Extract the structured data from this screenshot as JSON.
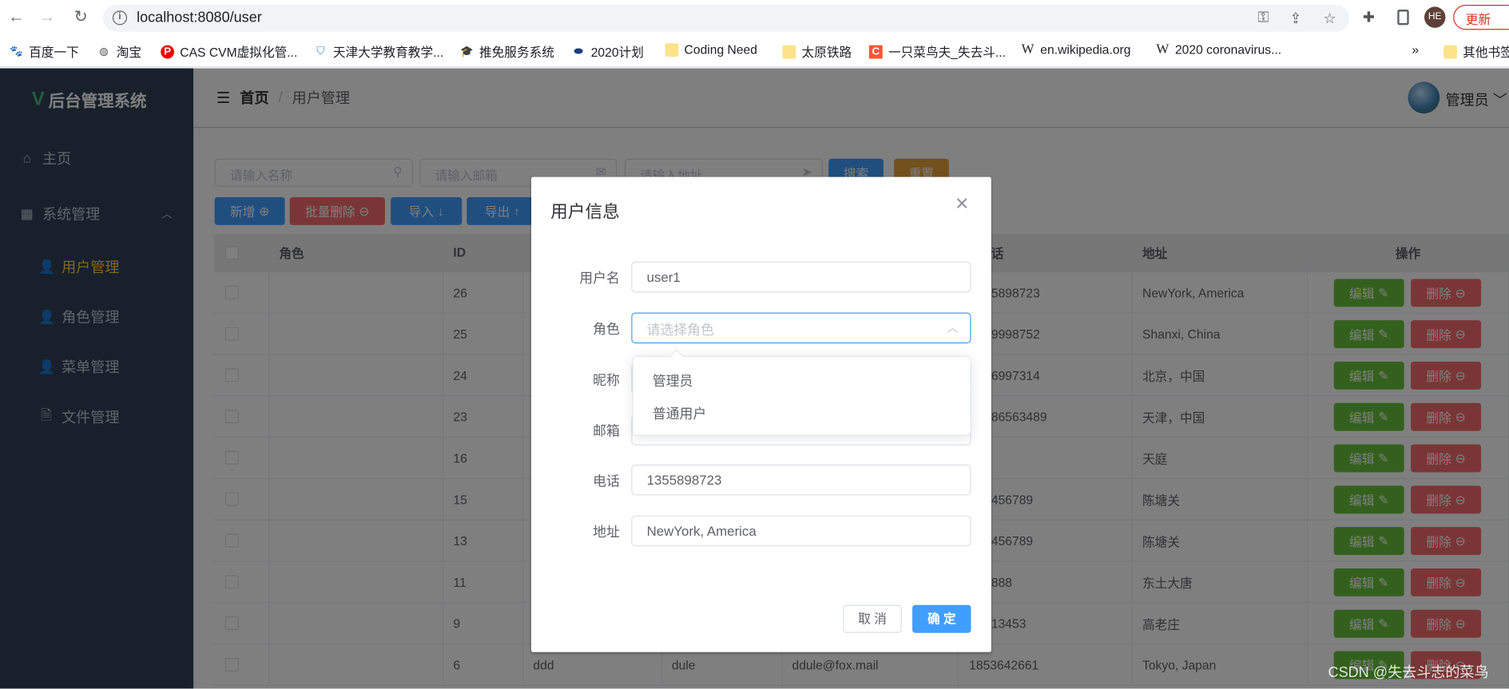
{
  "browser": {
    "url": "localhost:8080/user",
    "profile_initials": "HE",
    "update_label": "更新",
    "bookmarks": [
      "百度一下",
      "淘宝",
      "CAS CVM虚拟化管...",
      "天津大学教育教学...",
      "推免服务系统",
      "2020计划",
      "Coding Need",
      "太原铁路",
      "一只菜鸟夫_失去斗...",
      "en.wikipedia.org",
      "2020 coronavirus..."
    ],
    "more_bookmarks": "»",
    "other_bookmarks": "其他书签"
  },
  "sidebar": {
    "title": "后台管理系统",
    "logo_letter": "V",
    "items": [
      {
        "label": "主页",
        "icon": "home-icon"
      },
      {
        "label": "系统管理",
        "icon": "grid-icon"
      },
      {
        "label": "用户管理",
        "icon": "user-icon",
        "active": true
      },
      {
        "label": "角色管理",
        "icon": "user-icon"
      },
      {
        "label": "菜单管理",
        "icon": "user-icon"
      },
      {
        "label": "文件管理",
        "icon": "document-icon"
      }
    ]
  },
  "header": {
    "breadcrumb": [
      "首页",
      "用户管理"
    ],
    "separator": "/",
    "user": "管理员"
  },
  "search": {
    "name_placeholder": "请输入名称",
    "email_placeholder": "请输入邮箱",
    "address_placeholder": "请输入地址",
    "search_label": "搜索",
    "reset_label": "重置"
  },
  "toolbar": {
    "add": "新增",
    "batch_delete": "批量删除",
    "import": "导入",
    "export": "导出"
  },
  "table": {
    "columns": [
      "角色",
      "ID",
      "地址",
      "操作"
    ],
    "phone_header_fragment": "话",
    "edit_label": "编辑",
    "delete_label": "删除",
    "rows": [
      {
        "id": "26",
        "phone": "5898723",
        "address": "NewYork, America"
      },
      {
        "id": "25",
        "phone": "9998752",
        "address": "Shanxi, China"
      },
      {
        "id": "24",
        "phone": "6997314",
        "address": "北京，中国"
      },
      {
        "id": "23",
        "phone": "86563489",
        "address": "天津，中国"
      },
      {
        "id": "16",
        "phone": "",
        "address": "天庭"
      },
      {
        "id": "15",
        "phone": "456789",
        "address": "陈塘关"
      },
      {
        "id": "13",
        "phone": "456789",
        "address": "陈塘关"
      },
      {
        "id": "11",
        "phone": "888",
        "address": "东土大唐"
      },
      {
        "id": "9",
        "phone": "13453",
        "address": "高老庄"
      },
      {
        "id": "6",
        "username": "ddd",
        "nickname": "dule",
        "email": "ddule@fox.mail",
        "phone": "1853642661",
        "address": "Tokyo, Japan"
      }
    ]
  },
  "dialog": {
    "title": "用户信息",
    "fields": [
      {
        "label": "用户名",
        "value": "user1"
      },
      {
        "label": "角色",
        "placeholder": "请选择角色"
      },
      {
        "label": "昵称",
        "value": ""
      },
      {
        "label": "邮箱",
        "value": ""
      },
      {
        "label": "电话",
        "value": "1355898723"
      },
      {
        "label": "地址",
        "value": "NewYork, America"
      }
    ],
    "role_options": [
      "管理员",
      "普通用户"
    ],
    "cancel": "取 消",
    "confirm": "确 定"
  },
  "watermark": "CSDN @失去斗志的菜鸟",
  "colors": {
    "primary": "#409eff",
    "danger": "#f56c6c",
    "success": "#67c23a",
    "warning": "#e6a23c",
    "sidebar": "#304156",
    "active_menu": "#ffd04b"
  }
}
